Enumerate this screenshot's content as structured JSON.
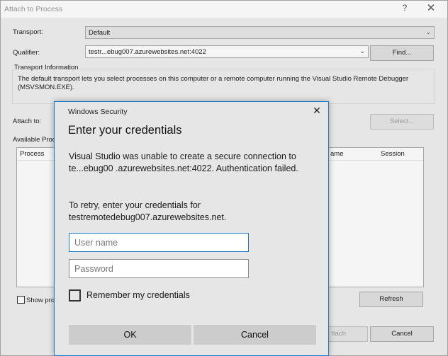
{
  "attach_window": {
    "title": "Attach to Process",
    "help_glyph": "?",
    "close_glyph": "✕",
    "transport_label": "Transport:",
    "transport_value": "Default",
    "qualifier_label": "Qualifier:",
    "qualifier_value": "testr...ebug007.azurewebsites.net:4022",
    "find_button": "Find...",
    "transport_info_title": "Transport Information",
    "transport_info_text": "The default transport lets you select processes on this computer or a remote computer running the Visual Studio Remote Debugger (MSVSMON.EXE).",
    "attach_to_label": "Attach to:",
    "select_button": "Select...",
    "available_processes_title": "Available Proce",
    "columns": [
      "Process",
      "ame",
      "Session"
    ],
    "show_processes_label": "Show proc",
    "refresh_button": "Refresh",
    "attach_button": "ttach",
    "cancel_button": "Cancel"
  },
  "security_dialog": {
    "title": "Windows Security",
    "close_glyph": "✕",
    "heading": "Enter your credentials",
    "message": "Visual Studio was unable to create a secure connection to te...ebug00 .azurewebsites.net:4022. Authentication failed.",
    "retry_message": "To retry, enter your credentials for testremotedebug007.azurewebsites.net.",
    "username_placeholder": "User name",
    "password_placeholder": "Password",
    "remember_label": "Remember my credentials",
    "ok_button": "OK",
    "cancel_button": "Cancel"
  },
  "colors": {
    "accent": "#1979ca",
    "dialog_background": "#e6e6e6",
    "window_background": "#f0f0f0"
  }
}
